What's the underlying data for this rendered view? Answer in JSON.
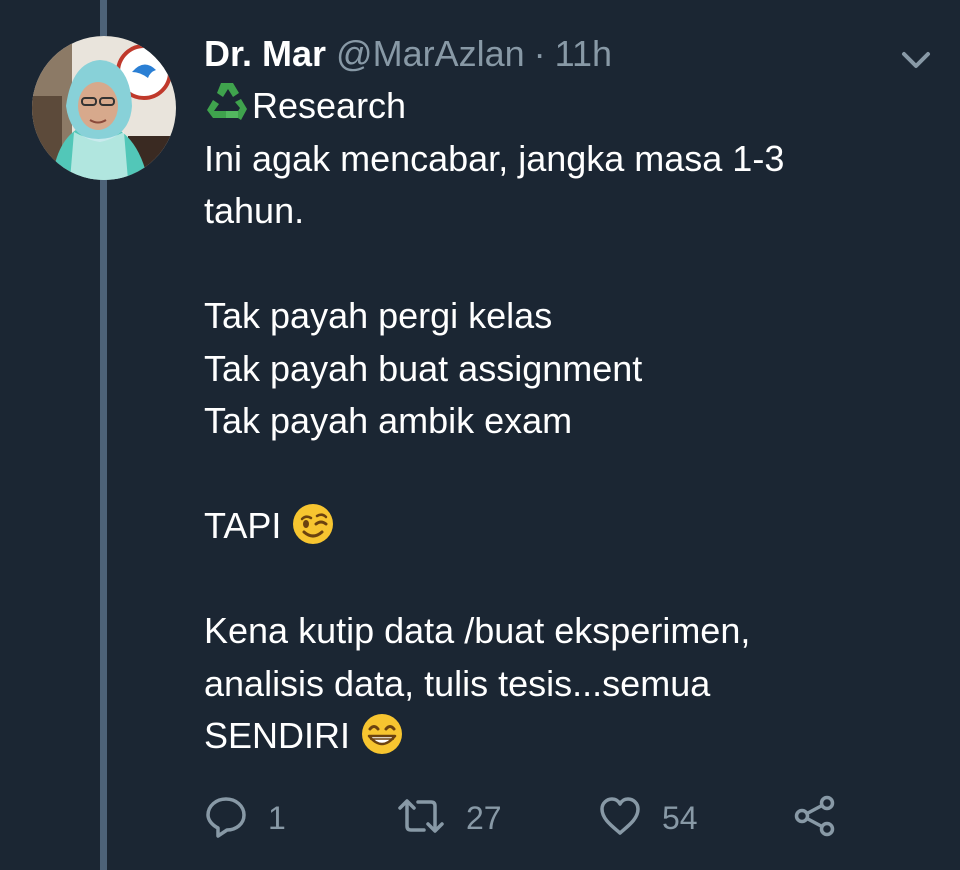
{
  "tweet": {
    "display_name": "Dr. Mar",
    "handle": "@MarAzlan",
    "separator": "·",
    "time": "11h",
    "avatar_icon": "profile-photo",
    "body": {
      "line1_text": "Research",
      "line1_icon": "recycle-emoji",
      "line2": "Ini agak mencabar, jangka masa 1-3",
      "line3": "tahun.",
      "line5": "Tak payah pergi kelas",
      "line6": "Tak payah buat assignment",
      "line7": "Tak payah ambik exam",
      "line9_text": "TAPI",
      "line9_icon": "winking-face-emoji",
      "line11": "Kena kutip data /buat eksperimen,",
      "line12": "analisis data, tulis tesis...semua",
      "line13_text": "SENDIRI",
      "line13_icon": "grinning-face-emoji"
    }
  },
  "actions": {
    "reply_count": "1",
    "retweet_count": "27",
    "like_count": "54",
    "reply_icon": "reply-icon",
    "retweet_icon": "retweet-icon",
    "like_icon": "heart-icon",
    "share_icon": "share-icon",
    "menu_icon": "chevron-down-icon"
  },
  "colors": {
    "background": "#1b2633",
    "thread_line": "#4d6278",
    "text": "#ffffff",
    "muted": "#8899a6"
  }
}
